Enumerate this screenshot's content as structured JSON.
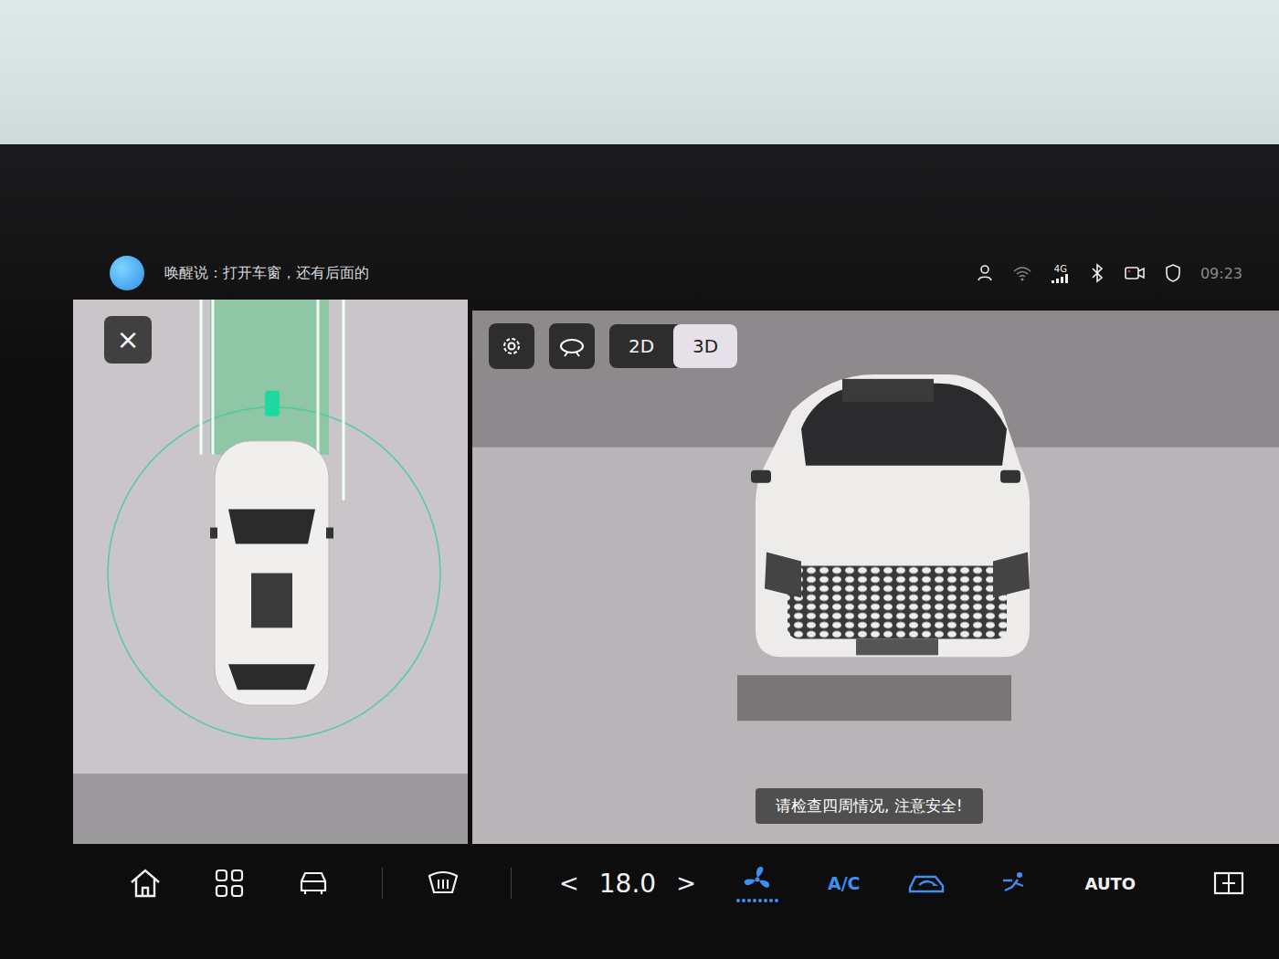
{
  "voice": {
    "hint": "唤醒说：打开车窗，还有后面的"
  },
  "status": {
    "network": "4G",
    "time": "09:23"
  },
  "surround_view": {
    "close": "×",
    "modes": [
      {
        "label": "2D",
        "selected": false
      },
      {
        "label": "3D",
        "selected": true
      }
    ],
    "warning": "请检查四周情况, 注意安全!"
  },
  "climate": {
    "decrease": "<",
    "temperature": "18.0",
    "increase": ">",
    "fan": {
      "on": true
    },
    "ac": {
      "label": "A/C",
      "on": true
    },
    "recirculation": {
      "on": true
    },
    "airflow": {
      "on": true
    },
    "auto": {
      "label": "AUTO",
      "on": false
    }
  }
}
